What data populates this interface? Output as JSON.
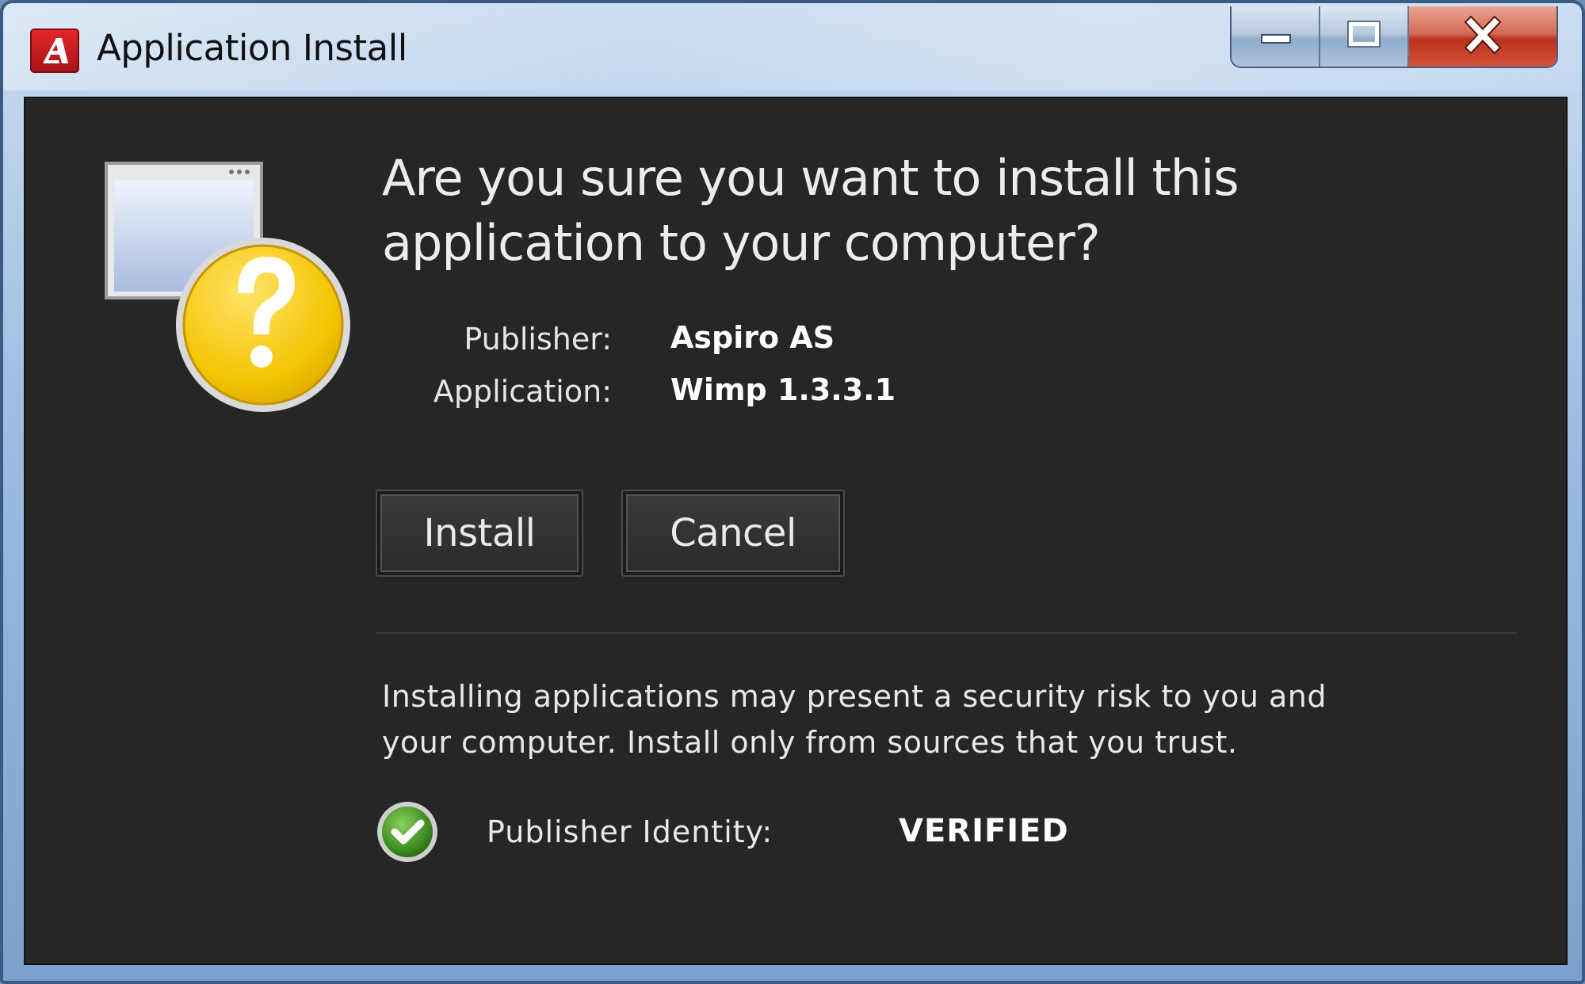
{
  "window": {
    "title": "Application Install",
    "icon": "adobe-air-icon",
    "caption_buttons": [
      "minimize-icon",
      "maximize-icon",
      "close-icon"
    ]
  },
  "dialog": {
    "heading_line1": "Are you sure you want to install this",
    "heading_line2": "application to your computer?",
    "hero_icon": "window-question-icon",
    "publisher_label": "Publisher:",
    "publisher_value": "Aspiro AS",
    "application_label": "Application:",
    "application_value": "Wimp 1.3.3.1",
    "install_label": "Install",
    "cancel_label": "Cancel",
    "warning_line1": "Installing applications may present a security risk to you and",
    "warning_line2": "your computer. Install only from sources that you trust.",
    "identity_icon": "green-checkmark-icon",
    "identity_label": "Publisher Identity:",
    "identity_value": "VERIFIED"
  },
  "colors": {
    "client_bg": "#262626",
    "question_yellow": "#f3c400",
    "check_green": "#3b8a1f",
    "close_red": "#c43a22"
  }
}
